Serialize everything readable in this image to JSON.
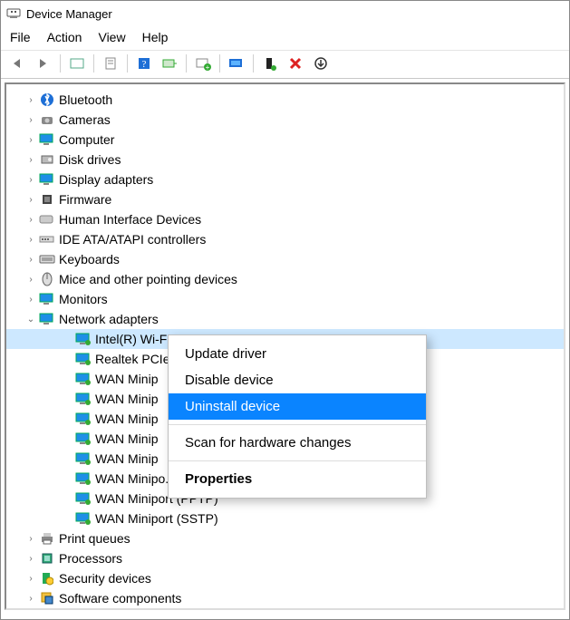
{
  "window": {
    "title": "Device Manager"
  },
  "menu": {
    "file": "File",
    "action": "Action",
    "view": "View",
    "help": "Help"
  },
  "toolbar_icons": {
    "back": "back-arrow-icon",
    "forward": "forward-arrow-icon",
    "show_hidden": "show-hidden-icon",
    "properties": "properties-sheet-icon",
    "help": "help-icon",
    "update": "update-driver-icon",
    "uninstall_legacy": "add-legacy-icon",
    "scan": "scan-hardware-icon",
    "enable": "enable-device-icon",
    "remove": "remove-device-icon",
    "scan_down": "scan-down-icon"
  },
  "tree": {
    "categories": [
      {
        "label": "Bluetooth",
        "icon": "bluetooth-icon",
        "expanded": false
      },
      {
        "label": "Cameras",
        "icon": "camera-icon",
        "expanded": false
      },
      {
        "label": "Computer",
        "icon": "monitor-icon",
        "expanded": false
      },
      {
        "label": "Disk drives",
        "icon": "disk-icon",
        "expanded": false
      },
      {
        "label": "Display adapters",
        "icon": "monitor-icon",
        "expanded": false
      },
      {
        "label": "Firmware",
        "icon": "chip-icon",
        "expanded": false
      },
      {
        "label": "Human Interface Devices",
        "icon": "hid-icon",
        "expanded": false
      },
      {
        "label": "IDE ATA/ATAPI controllers",
        "icon": "ide-icon",
        "expanded": false
      },
      {
        "label": "Keyboards",
        "icon": "keyboard-icon",
        "expanded": false
      },
      {
        "label": "Mice and other pointing devices",
        "icon": "mouse-icon",
        "expanded": false
      },
      {
        "label": "Monitors",
        "icon": "monitor-icon",
        "expanded": false
      },
      {
        "label": "Network adapters",
        "icon": "monitor-icon",
        "expanded": true,
        "children": [
          {
            "label": "Intel(R) Wi-F",
            "truncated": true,
            "selected": true
          },
          {
            "label": "Realtek PCIe",
            "truncated": true
          },
          {
            "label": "WAN Minip",
            "truncated": true
          },
          {
            "label": "WAN Minip",
            "truncated": true
          },
          {
            "label": "WAN Minip",
            "truncated": true
          },
          {
            "label": "WAN Minip",
            "truncated": true
          },
          {
            "label": "WAN Minip",
            "truncated": true
          },
          {
            "label": "WAN Minipo.. (.. . __)",
            "truncated": true
          },
          {
            "label": "WAN Miniport (PPTP)"
          },
          {
            "label": "WAN Miniport (SSTP)"
          }
        ]
      },
      {
        "label": "Print queues",
        "icon": "printer-icon",
        "expanded": false
      },
      {
        "label": "Processors",
        "icon": "cpu-icon",
        "expanded": false
      },
      {
        "label": "Security devices",
        "icon": "security-icon",
        "expanded": false
      },
      {
        "label": "Software components",
        "icon": "software-icon",
        "expanded": false
      }
    ]
  },
  "context_menu": {
    "items": [
      {
        "label": "Update driver"
      },
      {
        "label": "Disable device"
      },
      {
        "label": "Uninstall device",
        "highlighted": true
      },
      {
        "separator": true
      },
      {
        "label": "Scan for hardware changes"
      },
      {
        "separator": true
      },
      {
        "label": "Properties",
        "default": true
      }
    ]
  }
}
